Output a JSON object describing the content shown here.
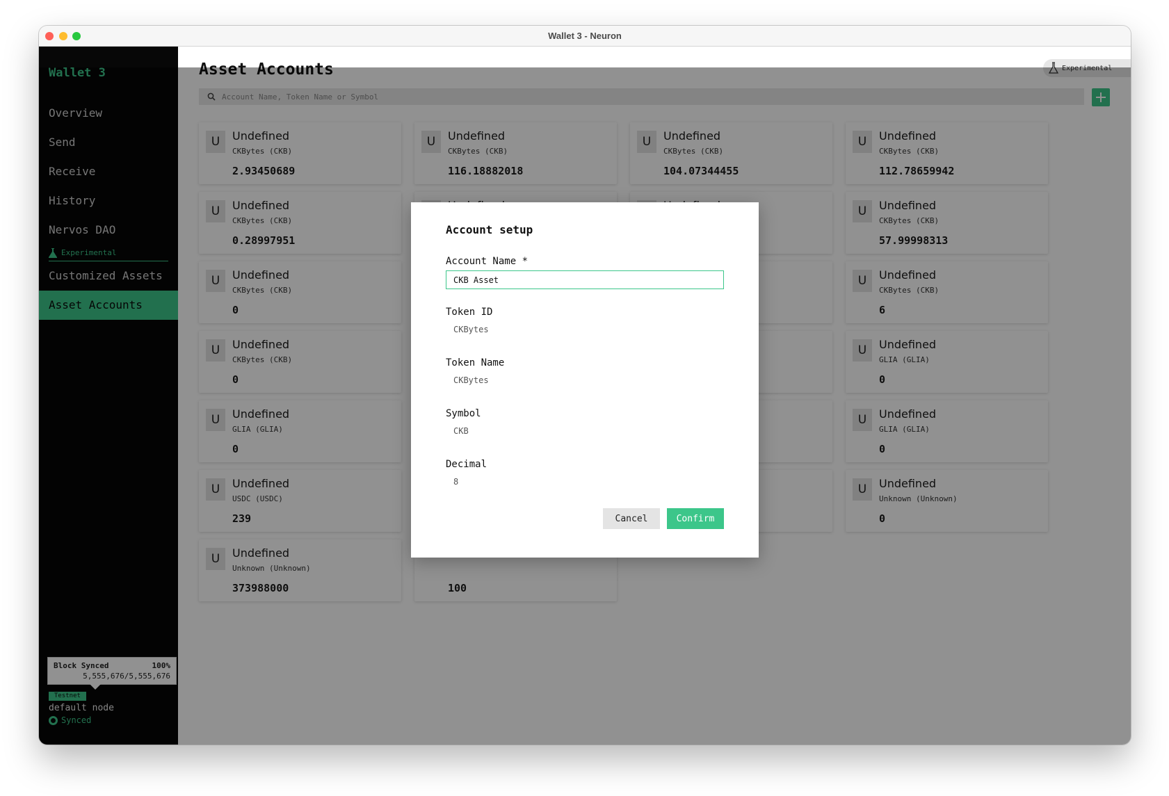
{
  "window": {
    "title": "Wallet 3 - Neuron"
  },
  "sidebar": {
    "wallet_name": "Wallet 3",
    "nav_items": [
      {
        "label": "Overview"
      },
      {
        "label": "Send"
      },
      {
        "label": "Receive"
      },
      {
        "label": "History"
      },
      {
        "label": "Nervos DAO"
      }
    ],
    "experimental_label": "Experimental",
    "experimental_items": [
      {
        "label": "Customized Assets"
      },
      {
        "label": "Asset Accounts",
        "active": true
      }
    ],
    "sync_tooltip": {
      "label": "Block Synced",
      "percent": "100%",
      "blocks": "5,555,676/5,555,676"
    },
    "network_badge": "Testnet",
    "node_name": "default node",
    "node_status": "Synced"
  },
  "main": {
    "title": "Asset Accounts",
    "experimental_button": "Experimental",
    "search_placeholder": "Account Name, Token Name or Symbol",
    "cards": [
      {
        "initial": "U",
        "name": "Undefined",
        "token": "CKBytes (CKB)",
        "balance": "2.93450689"
      },
      {
        "initial": "U",
        "name": "Undefined",
        "token": "CKBytes (CKB)",
        "balance": "116.18882018"
      },
      {
        "initial": "U",
        "name": "Undefined",
        "token": "CKBytes (CKB)",
        "balance": "104.07344455"
      },
      {
        "initial": "U",
        "name": "Undefined",
        "token": "CKBytes (CKB)",
        "balance": "112.78659942"
      },
      {
        "initial": "U",
        "name": "Undefined",
        "token": "CKBytes (CKB)",
        "balance": "0.28997951"
      },
      {
        "initial": "U",
        "name": "Undefined",
        "token": "",
        "balance": ""
      },
      {
        "initial": "U",
        "name": "Undefined",
        "token": "",
        "balance": ""
      },
      {
        "initial": "U",
        "name": "Undefined",
        "token": "CKBytes (CKB)",
        "balance": "57.99998313"
      },
      {
        "initial": "U",
        "name": "Undefined",
        "token": "CKBytes (CKB)",
        "balance": "0"
      },
      {
        "initial": "",
        "name": "",
        "token": "",
        "balance": ""
      },
      {
        "initial": "",
        "name": "",
        "token": "",
        "balance": ""
      },
      {
        "initial": "U",
        "name": "Undefined",
        "token": "CKBytes (CKB)",
        "balance": "6"
      },
      {
        "initial": "U",
        "name": "Undefined",
        "token": "CKBytes (CKB)",
        "balance": "0"
      },
      {
        "initial": "",
        "name": "",
        "token": "",
        "balance": ""
      },
      {
        "initial": "",
        "name": "",
        "token": "",
        "balance": ""
      },
      {
        "initial": "U",
        "name": "Undefined",
        "token": "GLIA (GLIA)",
        "balance": "0"
      },
      {
        "initial": "U",
        "name": "Undefined",
        "token": "GLIA (GLIA)",
        "balance": "0"
      },
      {
        "initial": "",
        "name": "",
        "token": "",
        "balance": ""
      },
      {
        "initial": "",
        "name": "",
        "token": "",
        "balance": ""
      },
      {
        "initial": "U",
        "name": "Undefined",
        "token": "GLIA (GLIA)",
        "balance": "0"
      },
      {
        "initial": "U",
        "name": "Undefined",
        "token": "USDC (USDC)",
        "balance": "239"
      },
      {
        "initial": "",
        "name": "",
        "token": "",
        "balance": ""
      },
      {
        "initial": "",
        "name": "",
        "token": "",
        "balance": ""
      },
      {
        "initial": "U",
        "name": "Undefined",
        "token": "Unknown (Unknown)",
        "balance": "0"
      },
      {
        "initial": "U",
        "name": "Undefined",
        "token": "Unknown (Unknown)",
        "balance": "373988000"
      },
      {
        "initial": "",
        "name": "",
        "token": "",
        "balance": "100"
      }
    ]
  },
  "dialog": {
    "title": "Account setup",
    "account_name_label": "Account Name *",
    "account_name_value": "CKB Asset",
    "token_id_label": "Token ID",
    "token_id_value": "CKBytes",
    "token_name_label": "Token Name",
    "token_name_value": "CKBytes",
    "symbol_label": "Symbol",
    "symbol_value": "CKB",
    "decimal_label": "Decimal",
    "decimal_value": "8",
    "cancel_label": "Cancel",
    "confirm_label": "Confirm"
  },
  "colors": {
    "accent": "#3cc68a",
    "sidebar_bg": "#070707",
    "overlay": "#000000"
  }
}
